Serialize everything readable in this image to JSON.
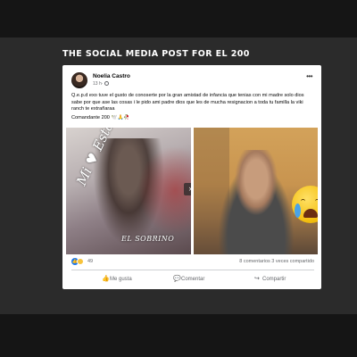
{
  "headline": "THE SOCIAL MEDIA POST FOR EL 200",
  "post": {
    "author": "Noelia Castro",
    "time": "13 h",
    "message": "Q.e.p.d exo tuve el gusto de conoserte por la gran amistad  de infancia que tenias con mi madre solo dios sabe por que ase las cosas i le pido ami padre dios que les de mucha resignacion a toda tu familla la viki ranch te extrañaraa",
    "tagline": "Comandante 200",
    "tagline_emoji": "🕊️🙏🥀"
  },
  "photo_left": {
    "script_text": "Mi ♥ Esta De Luto",
    "mark_text": "EL SOBRINO"
  },
  "reactions": {
    "count": "49",
    "comments_shares": "8 comentarios  3 veces compartido"
  },
  "actions": {
    "like": "Me gusta",
    "comment": "Comentar",
    "share": "Compartir"
  },
  "icons": {
    "more": "more-dots-icon",
    "privacy": "globe-icon",
    "next": "chevron-right-icon",
    "like": "thumbs-up-icon",
    "comment": "speech-bubble-icon",
    "share": "share-arrow-icon"
  },
  "colors": {
    "facebook_blue": "#1877f2",
    "secondary_text": "#65676b"
  }
}
